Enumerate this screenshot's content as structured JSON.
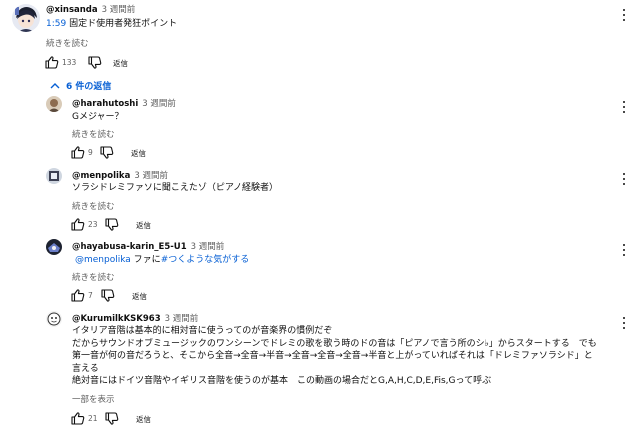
{
  "top_comment": {
    "handle": "@xinsanda",
    "time": "3 週間前",
    "timestamp_link": "1:59",
    "text": " 固定ド使用者発狂ポイント",
    "read_more": "続きを読む",
    "likes": "133",
    "reply_label": "返信"
  },
  "replies_toggle": {
    "label": "6 件の返信",
    "icon": "chevron-up-icon"
  },
  "replies": [
    {
      "handle": "@harahutoshi",
      "time": "3 週間前",
      "text": "Gメジャー？",
      "read_more": "続きを読む",
      "likes": "9",
      "reply_label": "返信"
    },
    {
      "handle": "@menpolika",
      "time": "3 週間前",
      "text": "ソラシドレミファソに聞こえたゾ（ピアノ経験者）",
      "read_more": "続きを読む",
      "likes": "23",
      "reply_label": "返信"
    },
    {
      "handle": "@hayabusa-karin_E5-U1",
      "time": "3 週間前",
      "mention": "@menpolika",
      "text_mid": " ファに",
      "hashtag": "#つくような気がする",
      "read_more": "続きを読む",
      "likes": "7",
      "reply_label": "返信"
    },
    {
      "handle": "@KurumilkKSK963",
      "time": "3 週間前",
      "lines": [
        "イタリア音階は基本的に相対音に使うってのが音楽界の慣例だぞ",
        "だからサウンドオブミュージックのワンシーンでドレミの歌を歌う時のドの音は「ピアノで言う所のシ♭」からスタートする　でも",
        "第一音が何の音だろうと、そこから全音→全音→半音→全音→全音→全音→半音と上がっていればそれは「ドレミファソラシド」と",
        "言える",
        "絶対音にはドイツ音階やイギリス音階を使うのが基本　この動画の場合だとG,A,H,C,D,E,Fis,Gって呼ぶ"
      ],
      "read_more": "一部を表示",
      "likes": "21",
      "reply_label": "返信"
    }
  ],
  "icons": [
    "thumb-up-icon",
    "thumb-down-icon",
    "more-vert-icon",
    "chevron-up-icon"
  ],
  "colors": {
    "link": "#065fd4",
    "secondary_text": "#606060",
    "primary_text": "#0f0f0f"
  }
}
